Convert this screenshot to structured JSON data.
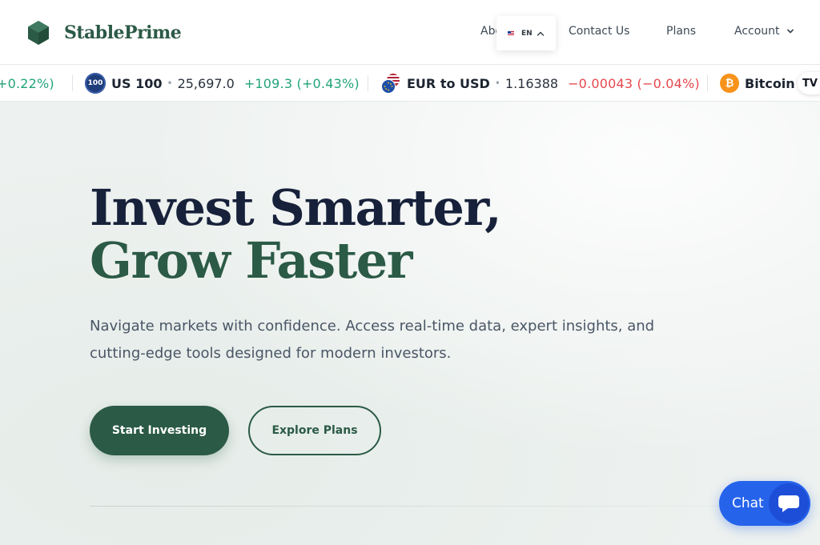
{
  "brand": {
    "name": "StablePrime",
    "color": "#2b5a46"
  },
  "nav": {
    "about": "About",
    "contact": "Contact Us",
    "plans": "Plans",
    "account": "Account"
  },
  "language": {
    "code": "EN",
    "flag": "us-flag-icon"
  },
  "ticker": [
    {
      "change": "+0.22%)",
      "direction": "up"
    },
    {
      "symbol": "US 100",
      "icon_text": "100",
      "price": "25,697.0",
      "change": "+109.3 (+0.43%)",
      "direction": "up"
    },
    {
      "symbol": "EUR to USD",
      "price": "1.16388",
      "change": "−0.00043 (−0.04%)",
      "direction": "down"
    },
    {
      "symbol": "Bitcoin",
      "icon_text": "₿"
    }
  ],
  "ticker_provider": "TV",
  "colors": {
    "positive": "#22a37a",
    "negative": "#e5484d",
    "accent": "#2563eb"
  },
  "hero": {
    "line1": "Invest Smarter,",
    "line2": "Grow Faster",
    "subtitle": "Navigate markets with confidence. Access real-time data, expert insights, and cutting-edge tools designed for modern investors.",
    "primary_cta": "Start Investing",
    "secondary_cta": "Explore Plans"
  },
  "chat": {
    "label": "Chat"
  }
}
